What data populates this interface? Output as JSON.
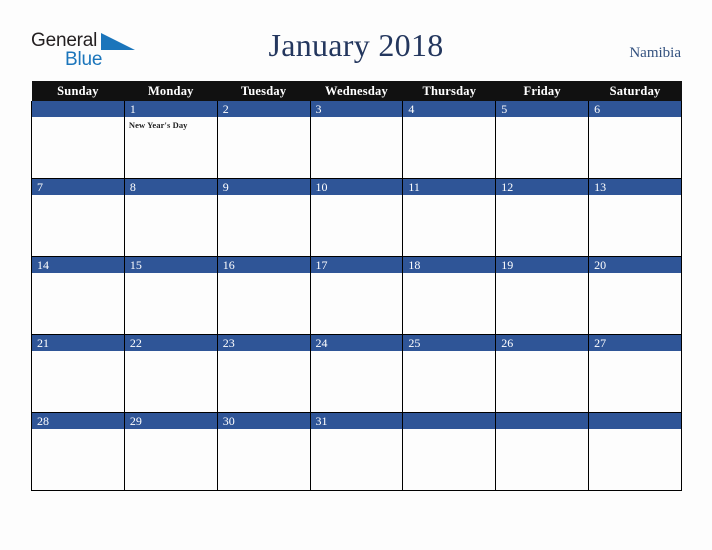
{
  "brand": {
    "name_part1": "General",
    "name_part2": "Blue",
    "mark": "triangle-flag-icon",
    "colors": {
      "dark_text": "#231f20",
      "blue_text": "#1b75bb"
    }
  },
  "header": {
    "title": "January 2018",
    "region": "Namibia"
  },
  "colors": {
    "page_background": "#fdfdfd",
    "weekday_header_background": "#111111",
    "weekday_header_text": "#ffffff",
    "date_band_background": "#2f5597",
    "date_band_text": "#ffffff",
    "title_text": "#24375e",
    "region_text": "#33517f",
    "grid_line": "#000000"
  },
  "calendar": {
    "month": "January",
    "year": "2018",
    "weekday_headers": [
      "Sunday",
      "Monday",
      "Tuesday",
      "Wednesday",
      "Thursday",
      "Friday",
      "Saturday"
    ],
    "weeks": [
      [
        {
          "day": "",
          "event": ""
        },
        {
          "day": "1",
          "event": "New Year's Day"
        },
        {
          "day": "2",
          "event": ""
        },
        {
          "day": "3",
          "event": ""
        },
        {
          "day": "4",
          "event": ""
        },
        {
          "day": "5",
          "event": ""
        },
        {
          "day": "6",
          "event": ""
        }
      ],
      [
        {
          "day": "7",
          "event": ""
        },
        {
          "day": "8",
          "event": ""
        },
        {
          "day": "9",
          "event": ""
        },
        {
          "day": "10",
          "event": ""
        },
        {
          "day": "11",
          "event": ""
        },
        {
          "day": "12",
          "event": ""
        },
        {
          "day": "13",
          "event": ""
        }
      ],
      [
        {
          "day": "14",
          "event": ""
        },
        {
          "day": "15",
          "event": ""
        },
        {
          "day": "16",
          "event": ""
        },
        {
          "day": "17",
          "event": ""
        },
        {
          "day": "18",
          "event": ""
        },
        {
          "day": "19",
          "event": ""
        },
        {
          "day": "20",
          "event": ""
        }
      ],
      [
        {
          "day": "21",
          "event": ""
        },
        {
          "day": "22",
          "event": ""
        },
        {
          "day": "23",
          "event": ""
        },
        {
          "day": "24",
          "event": ""
        },
        {
          "day": "25",
          "event": ""
        },
        {
          "day": "26",
          "event": ""
        },
        {
          "day": "27",
          "event": ""
        }
      ],
      [
        {
          "day": "28",
          "event": ""
        },
        {
          "day": "29",
          "event": ""
        },
        {
          "day": "30",
          "event": ""
        },
        {
          "day": "31",
          "event": ""
        },
        {
          "day": "",
          "event": ""
        },
        {
          "day": "",
          "event": ""
        },
        {
          "day": "",
          "event": ""
        }
      ]
    ]
  }
}
